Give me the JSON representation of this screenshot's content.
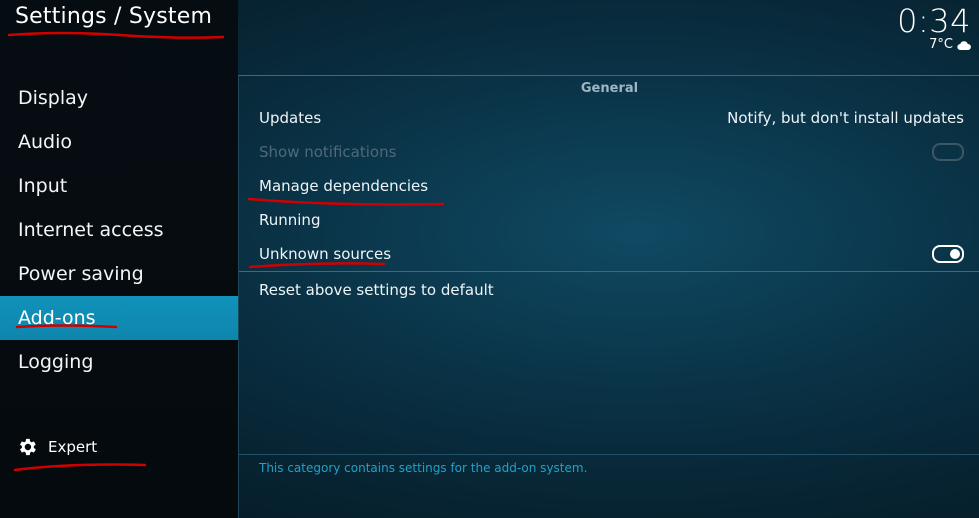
{
  "header": {
    "title": "Settings / System",
    "clock": "0:34",
    "temperature": "7°C",
    "weather_icon": "cloud-icon"
  },
  "sidebar": {
    "items": [
      {
        "label": "Display"
      },
      {
        "label": "Audio"
      },
      {
        "label": "Input"
      },
      {
        "label": "Internet access"
      },
      {
        "label": "Power saving"
      },
      {
        "label": "Add-ons",
        "active": true
      },
      {
        "label": "Logging"
      }
    ],
    "expert": {
      "label": "Expert",
      "icon": "gear-icon"
    }
  },
  "main": {
    "section": "General",
    "settings": [
      {
        "label": "Updates",
        "value": "Notify, but don't install updates"
      },
      {
        "label": "Show notifications",
        "toggle": false,
        "disabled": true
      },
      {
        "label": "Manage dependencies"
      },
      {
        "label": "Running"
      },
      {
        "label": "Unknown sources",
        "toggle": true
      }
    ],
    "reset_label": "Reset above settings to default",
    "description": "This category contains settings for the add-on system."
  },
  "colors": {
    "accent": "#12a0c7",
    "annotation": "#d10000",
    "footer_text": "#1fa2c7"
  }
}
